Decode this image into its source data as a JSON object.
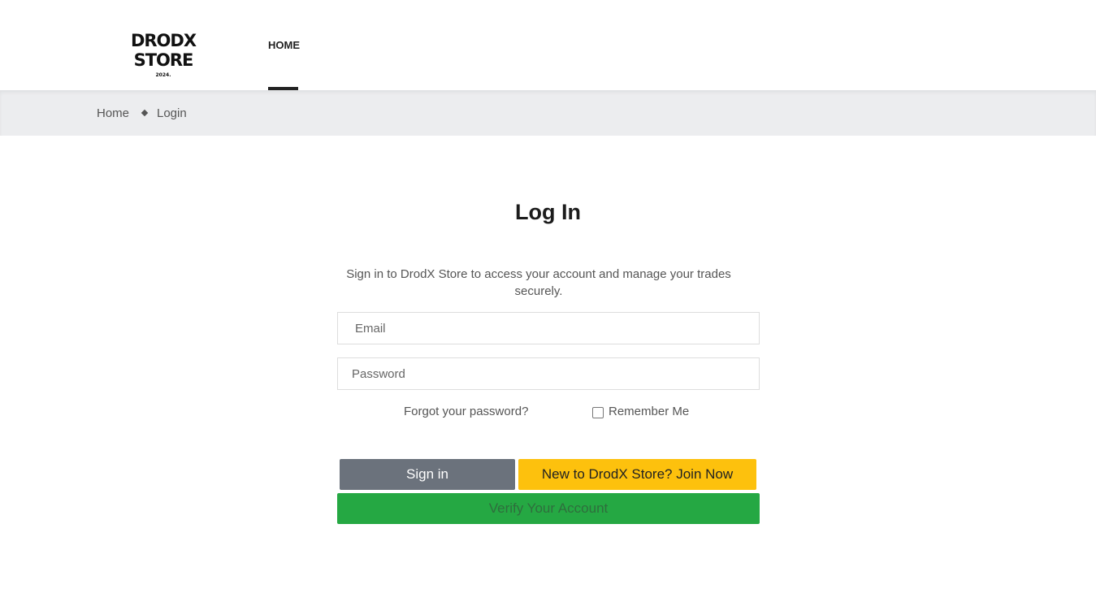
{
  "header": {
    "logo_main": "DRODX STORE",
    "logo_sub": "2024.",
    "nav_home": "HOME"
  },
  "breadcrumb": {
    "home": "Home",
    "current": "Login"
  },
  "login": {
    "title": "Log In",
    "subtitle": "Sign in to DrodX Store to access your account and manage your trades securely.",
    "email_placeholder": "Email",
    "password_placeholder": "Password",
    "forgot": "Forgot your password?",
    "remember": "Remember Me",
    "remember_checked": false,
    "signin": "Sign in",
    "join": "New to DrodX Store? Join Now",
    "verify": "Verify Your Account"
  },
  "colors": {
    "signin_bg": "#6b727c",
    "join_bg": "#fdc10d",
    "verify_bg": "#25a843",
    "breadcrumb_bg": "#ecedef"
  }
}
